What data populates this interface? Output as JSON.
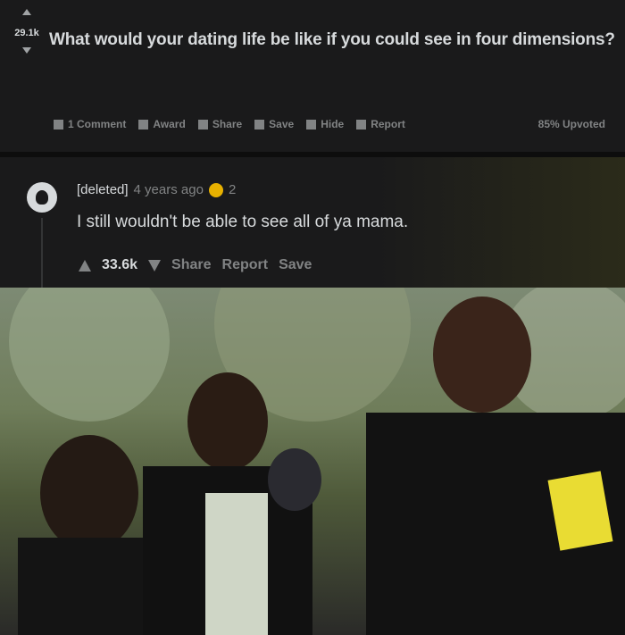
{
  "post": {
    "score": "29.1k",
    "title": "What would your dating life be like if you could see in four dimensions?",
    "actions": [
      {
        "icon": "comment-icon",
        "label": "1 Comment"
      },
      {
        "icon": "award-icon",
        "label": "Award"
      },
      {
        "icon": "share-icon",
        "label": "Share"
      },
      {
        "icon": "save-icon",
        "label": "Save"
      },
      {
        "icon": "hide-icon",
        "label": "Hide"
      },
      {
        "icon": "report-icon",
        "label": "Report"
      }
    ],
    "upvoted": "85% Upvoted"
  },
  "comment": {
    "author": "[deleted]",
    "time": "4 years ago",
    "award_count": "2",
    "text": "I still wouldn't be able to see all of ya mama.",
    "score": "33.6k",
    "share": "Share",
    "report": "Report",
    "save": "Save"
  }
}
